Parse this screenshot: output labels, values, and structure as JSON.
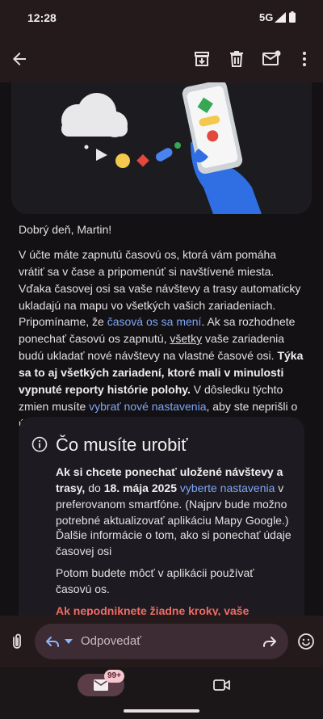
{
  "status_bar": {
    "time": "12:28",
    "network": "5G"
  },
  "app_bar": {
    "icons": [
      "back-arrow-icon",
      "archive-icon",
      "delete-icon",
      "mark-unread-icon",
      "more-vert-icon"
    ]
  },
  "email": {
    "greeting": "Dobrý deň, Martin!",
    "p1": "V účte máte zapnutú časovú os, ktorá vám pomáha vrátiť sa v čase a pripomenúť si navštívené miesta. Vďaka časovej osi sa vaše návštevy a trasy automaticky ukladajú na mapu vo všetkých vašich zariadeniach.",
    "p2": {
      "t1": "Pripomíname, že ",
      "link1": "časová os sa mení",
      "t2": ". Ak sa rozhodnete ponechať časovú os zapnutú, ",
      "u1": "všetky",
      "t3": " vaše zariadenia budú ukladať nové návštevy na vlastné časové osi. ",
      "b1": "Týka sa to aj všetkých zariadení, ktoré mali v minulosti vypnuté reporty histórie polohy.",
      "t4": " V dôsledku týchto zmien musíte ",
      "link2": "vybrať nové nastavenia",
      "t5": ", aby ste neprišli o údaje časovej osi."
    },
    "card": {
      "title": "Čo musíte urobiť",
      "b1": "Ak si chcete ponechať uložené návštevy a trasy,",
      "t1": " do ",
      "b2": "18. mája 2025",
      "link1": " vyberte nastavenia",
      "t2": " v preferovanom smartfóne. (Najprv bude možno potrebné aktualizovať aplikáciu Mapy Google.)",
      "link2": "Ďalšie informácie o tom, ako si ponechať údaje časovej osi",
      "p2": "Potom budete môcť v aplikácii používať časovú os.",
      "warning": "Ak nepodniknete žiadne kroky, vaše návštevy"
    }
  },
  "reply_bar": {
    "placeholder": "Odpovedať"
  },
  "bottom_nav": {
    "mail_badge": "99+"
  },
  "colors": {
    "link": "#7ea6f5",
    "warning": "#f36b62",
    "accent_pill": "#5a3d46"
  }
}
